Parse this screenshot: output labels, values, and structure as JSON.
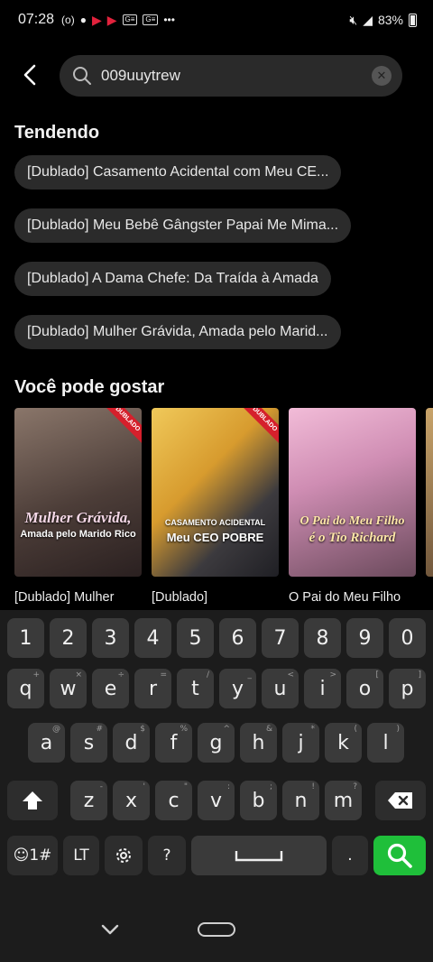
{
  "status": {
    "time": "07:28",
    "battery": "83%"
  },
  "search": {
    "value": "009uuytrew"
  },
  "trending": {
    "heading": "Tendendo",
    "items": [
      "[Dublado] Casamento Acidental com Meu CE...",
      "[Dublado] Meu Bebê Gângster Papai Me Mima...",
      "[Dublado] A Dama Chefe: Da Traída à Amada",
      "[Dublado] Mulher Grávida, Amada pelo Marid..."
    ]
  },
  "recommend": {
    "heading": "Você pode gostar",
    "badge": "DUBLADO",
    "cards": [
      {
        "title": "[Dublado] Mulher",
        "poster_line1": "Mulher Grávida,",
        "poster_line2": "Amada pelo Marido Rico",
        "colors": [
          "#6b5a52",
          "#3a2d2a"
        ]
      },
      {
        "title": "[Dublado]",
        "poster_line1": "CASAMENTO ACIDENTAL",
        "poster_line2": "Meu CEO POBRE",
        "colors": [
          "#e4b84a",
          "#5a4a3a"
        ]
      },
      {
        "title": "O Pai do Meu Filho",
        "poster_line1": "O Pai do Meu Filho",
        "poster_line2": "é o Tio Richard",
        "colors": [
          "#e7a8c9",
          "#8d5b76"
        ]
      }
    ]
  },
  "keyboard": {
    "numbers": [
      "1",
      "2",
      "3",
      "4",
      "5",
      "6",
      "7",
      "8",
      "9",
      "0"
    ],
    "row1": [
      "q",
      "w",
      "e",
      "r",
      "t",
      "y",
      "u",
      "i",
      "o",
      "p"
    ],
    "row1_hints": [
      "+",
      "×",
      "÷",
      "=",
      "/",
      "_",
      "<",
      ">",
      "[",
      "]"
    ],
    "row2": [
      "a",
      "s",
      "d",
      "f",
      "g",
      "h",
      "j",
      "k",
      "l"
    ],
    "row2_hints": [
      "@",
      "#",
      "$",
      "%",
      "^",
      "&",
      "*",
      "(",
      ")"
    ],
    "row3": [
      "z",
      "x",
      "c",
      "v",
      "b",
      "n",
      "m"
    ],
    "row3_hints": [
      "-",
      "'",
      "\"",
      ":",
      ";",
      "!",
      "?"
    ],
    "symbols_label": "☺1#",
    "lang_label": "LT",
    "question_label": "?",
    "period_label": ".",
    "accent_color": "#1fbf3a"
  }
}
